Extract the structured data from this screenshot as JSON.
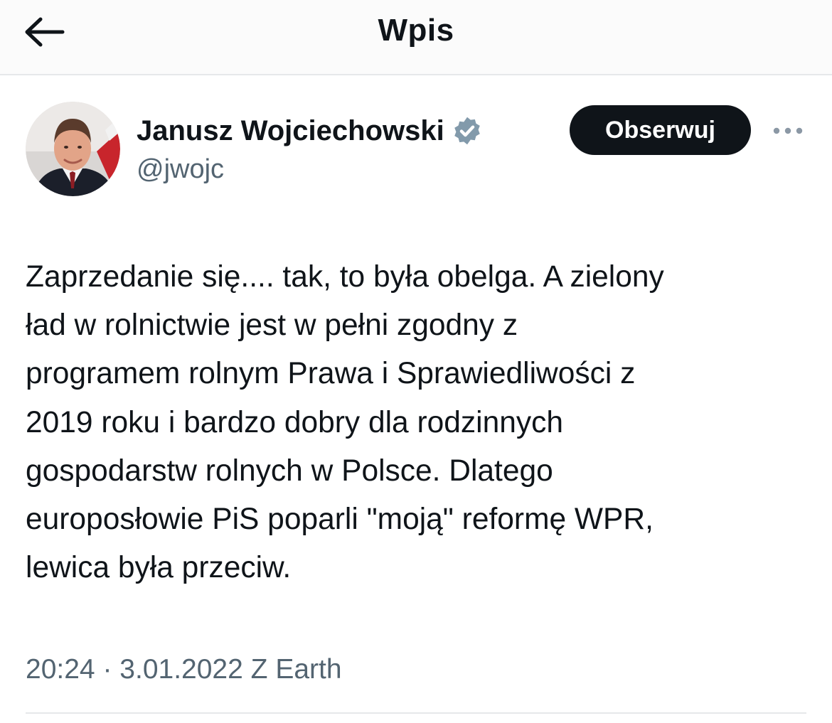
{
  "header": {
    "title": "Wpis",
    "back_icon": "arrow-left-icon"
  },
  "author": {
    "name": "Janusz Wojciechowski",
    "handle": "@jwojc",
    "verified_icon": "verified-badge-icon",
    "badge_color": "#829aab"
  },
  "actions": {
    "follow_label": "Obserwuj",
    "more_icon": "more-horizontal-icon"
  },
  "tweet": {
    "lines": [
      "Zaprzedanie się.... tak, to była obelga. A zielony",
      "ład w rolnictwie jest w pełni zgodny z",
      "programem rolnym Prawa i Sprawiedliwości z",
      "2019 roku i bardzo dobry dla rodzinnych",
      "gospodarstw rolnych w Polsce. Dlatego",
      "europosłowie PiS poparli \"moją\" reformę WPR,",
      "lewica była przeciw."
    ]
  },
  "meta": {
    "time": "20:24",
    "separator": "·",
    "date": "3.01.2022",
    "source": "Z Earth"
  },
  "colors": {
    "text": "#0f1419",
    "secondary": "#536471",
    "button_bg": "#0f1419",
    "button_text": "#ffffff",
    "divider": "#e6e8ea"
  }
}
